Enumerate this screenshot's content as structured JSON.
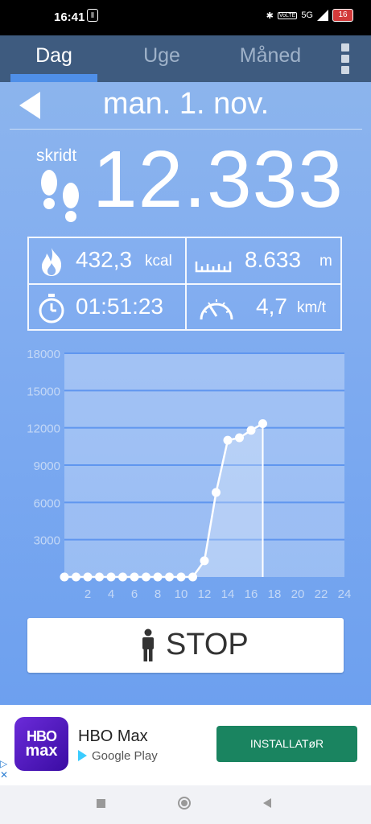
{
  "status_bar": {
    "time": "16:41",
    "network": "5G",
    "volte": "VoLTE",
    "battery": "16"
  },
  "tabs": [
    {
      "label": "Dag",
      "active": true
    },
    {
      "label": "Uge",
      "active": false
    },
    {
      "label": "Måned",
      "active": false
    }
  ],
  "date": "man. 1. nov.",
  "steps": {
    "label": "skridt",
    "value": "12.333"
  },
  "stats": {
    "calories": {
      "value": "432,3",
      "unit": "kcal"
    },
    "distance": {
      "value": "8.633",
      "unit": "m"
    },
    "duration": {
      "value": "01:51:23"
    },
    "speed": {
      "value": "4,7",
      "unit": "km/t"
    }
  },
  "chart_data": {
    "type": "line",
    "x": [
      0,
      1,
      2,
      3,
      4,
      5,
      6,
      7,
      8,
      9,
      10,
      11,
      12,
      13,
      14,
      15,
      16,
      17
    ],
    "values": [
      0,
      0,
      0,
      0,
      0,
      0,
      0,
      0,
      0,
      0,
      0,
      0,
      1300,
      6800,
      11000,
      11200,
      11800,
      12333
    ],
    "x_ticks": [
      "2",
      "4",
      "6",
      "8",
      "10",
      "12",
      "14",
      "16",
      "18",
      "20",
      "22",
      "24"
    ],
    "y_ticks": [
      "3000",
      "6000",
      "9000",
      "12000",
      "15000",
      "18000"
    ],
    "xlim": [
      0,
      24
    ],
    "ylim": [
      0,
      18000
    ],
    "grid": true
  },
  "stop_button": {
    "label": "STOP"
  },
  "ad": {
    "app_name": "HBO Max",
    "logo_line1": "HBO",
    "logo_line2": "max",
    "store": "Google Play",
    "install_label": "INSTALLATøR"
  }
}
